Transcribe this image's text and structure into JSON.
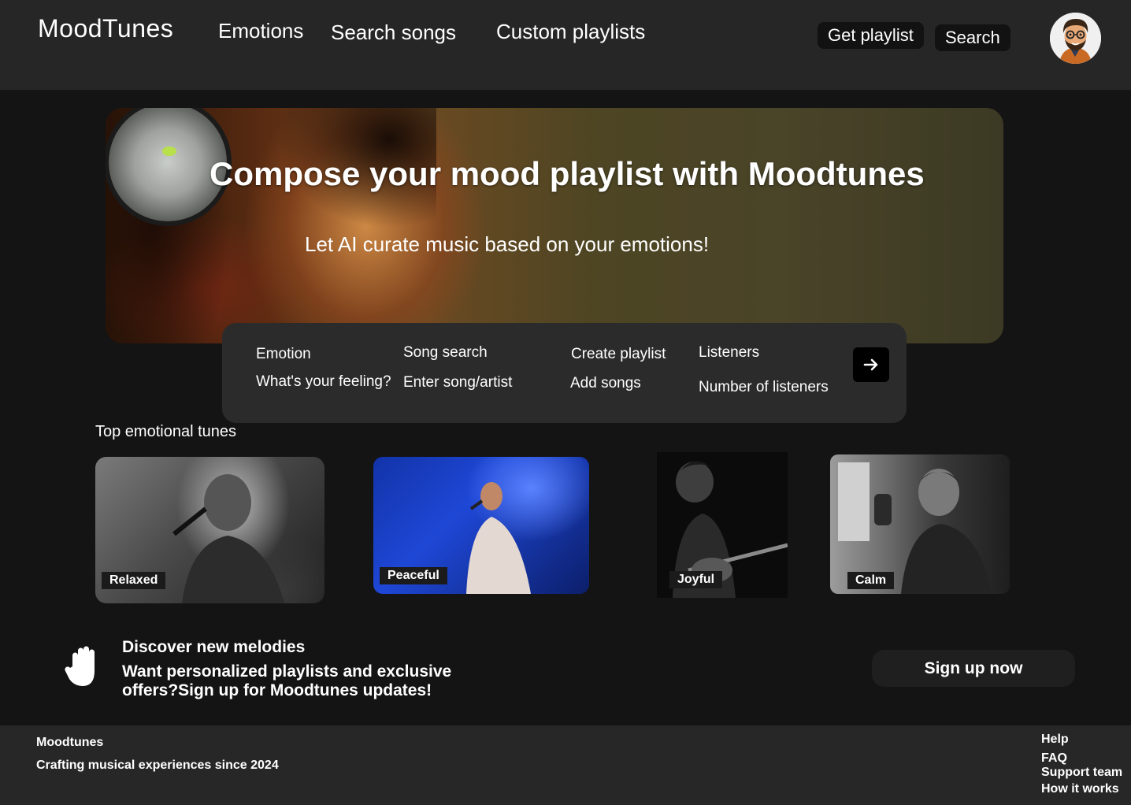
{
  "header": {
    "brand": "MoodTunes",
    "nav": [
      "Emotions",
      "Search songs",
      "Custom playlists"
    ],
    "buttons": {
      "get_playlist": "Get playlist",
      "search": "Search"
    }
  },
  "hero": {
    "title": "Compose your mood playlist with Moodtunes",
    "subtitle": "Let AI curate music based on your emotions!"
  },
  "search_panel": {
    "fields": [
      {
        "label": "Emotion",
        "value": "What's your feeling?"
      },
      {
        "label": "Song search",
        "value": "Enter song/artist"
      },
      {
        "label": "Create playlist",
        "value": "Add songs"
      },
      {
        "label": "Listeners",
        "value": "Number of listeners"
      }
    ],
    "submit_icon": "arrow-right-icon"
  },
  "tunes": {
    "title": "Top emotional tunes",
    "cards": [
      {
        "label": "Relaxed"
      },
      {
        "label": "Peaceful"
      },
      {
        "label": "Joyful"
      },
      {
        "label": "Calm"
      }
    ]
  },
  "promo": {
    "icon": "hand-icon",
    "title": "Discover new melodies",
    "text": "Want personalized playlists and exclusive offers?Sign up for Moodtunes updates!",
    "cta": "Sign up now"
  },
  "footer": {
    "brand": "Moodtunes",
    "tagline": "Crafting musical experiences since 2024",
    "links": [
      "Help",
      "FAQ",
      "Support team",
      "How it works"
    ]
  }
}
